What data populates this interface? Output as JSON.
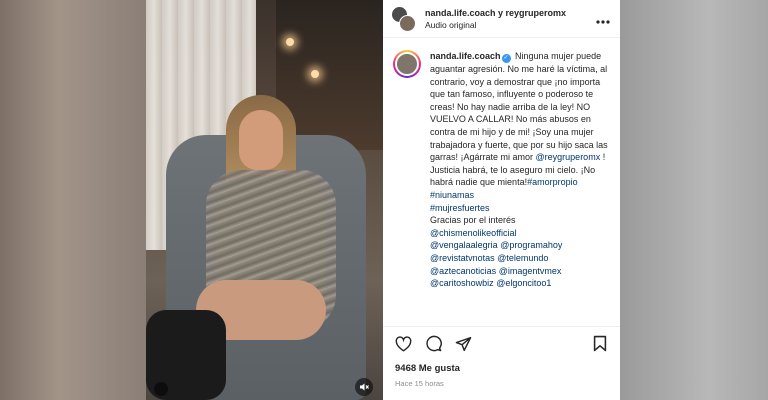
{
  "header": {
    "owners": "nanda.life.coach y reygruperomx",
    "audio": "Audio original",
    "more_icon": "more-horizontal-icon"
  },
  "post": {
    "username": "nanda.life.coach",
    "caption_1": "Ninguna mujer puede aguantar agresión. No me haré la víctima, al contrario, voy a demostrar que ¡no importa que tan famoso, influyente o poderoso te creas! No hay nadie arriba de la ley! NO VUELVO A CALLAR! No más abusos en contra de mi hijo y de mi! ¡Soy una mujer trabajadora y fuerte, que por su hijo saca las garras! ¡Agárrate mi amor ",
    "mention_1": "@reygruperomx",
    "caption_2": " ! Justicia habrá, te lo aseguro mi cielo. ¡No habrá nadie que mienta!",
    "hashtags": [
      "#amorpropio",
      "#niunamas",
      "#mujresfuertes"
    ],
    "thanks": "Gracias por el interés",
    "mentions": [
      "@chismenolikeofficial",
      "@vengalaalegria",
      "@programahoy",
      "@revistatvnotas",
      "@telemundo",
      "@aztecanoticias",
      "@imagentvmex",
      "@caritoshowbiz",
      "@elgoncitoo1"
    ]
  },
  "actions": {
    "like_icon": "heart-icon",
    "comment_icon": "comment-icon",
    "share_icon": "send-icon",
    "save_icon": "bookmark-icon"
  },
  "likes": "9468 Me gusta",
  "time": "Hace 15 horas",
  "colors": {
    "text": "#262626",
    "link": "#00376b",
    "verified": "#3897f0",
    "muted": "#8e8e8e"
  }
}
